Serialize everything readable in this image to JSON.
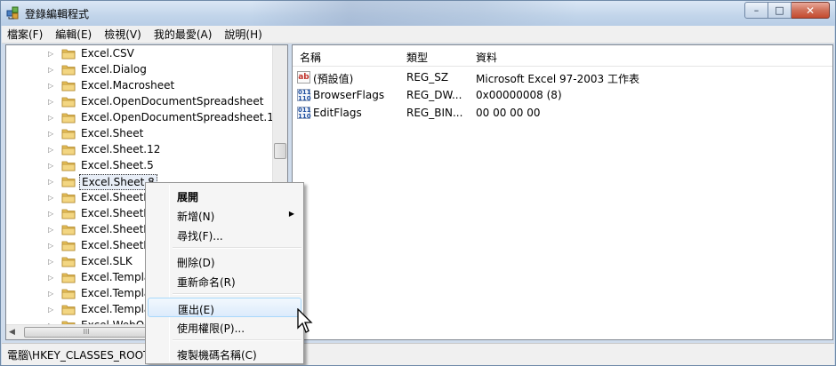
{
  "window": {
    "title": "登錄編輯程式",
    "minimize_glyph": "–",
    "maximize_glyph": "□",
    "close_glyph": "✕"
  },
  "menubar": [
    "檔案(F)",
    "編輯(E)",
    "檢視(V)",
    "我的最愛(A)",
    "說明(H)"
  ],
  "tree": {
    "items": [
      "Excel.CSV",
      "Excel.Dialog",
      "Excel.Macrosheet",
      "Excel.OpenDocumentSpreadsheet",
      "Excel.OpenDocumentSpreadsheet.12",
      "Excel.Sheet",
      "Excel.Sheet.12",
      "Excel.Sheet.5",
      "Excel.Sheet.8",
      "Excel.SheetBi",
      "Excel.SheetBi",
      "Excel.SheetM",
      "Excel.SheetM",
      "Excel.SLK",
      "Excel.Templa",
      "Excel.Templa",
      "Excel.Templa",
      "Excel.WebQu"
    ],
    "selected_index": 8,
    "expander_glyph": "▷",
    "hscroll_thumb": "III"
  },
  "list": {
    "headers": {
      "name": "名稱",
      "type": "類型",
      "data": "資料"
    },
    "rows": [
      {
        "icon": "string-value-icon",
        "icon_text": "ab",
        "name": "(預設值)",
        "type": "REG_SZ",
        "data": "Microsoft Excel 97-2003 工作表"
      },
      {
        "icon": "binary-value-icon",
        "icon_text": "011\n110",
        "name": "BrowserFlags",
        "type": "REG_DW...",
        "data": "0x00000008 (8)"
      },
      {
        "icon": "binary-value-icon",
        "icon_text": "011\n110",
        "name": "EditFlags",
        "type": "REG_BIN...",
        "data": "00 00 00 00"
      }
    ]
  },
  "status": "電腦\\HKEY_CLASSES_ROOT",
  "context_menu": {
    "items": [
      {
        "label": "展開",
        "bold": true
      },
      {
        "label": "新增(N)",
        "submenu": true,
        "arrow": "▶"
      },
      {
        "label": "尋找(F)..."
      },
      {
        "label": "刪除(D)"
      },
      {
        "label": "重新命名(R)"
      },
      {
        "label": "匯出(E)",
        "hover": true
      },
      {
        "label": "使用權限(P)..."
      },
      {
        "label": "複製機碼名稱(C)"
      }
    ]
  },
  "colors": {
    "titlebar": "#c2d5ea",
    "selection_hover": "#dcebfc",
    "folder": "#e8c15a"
  }
}
